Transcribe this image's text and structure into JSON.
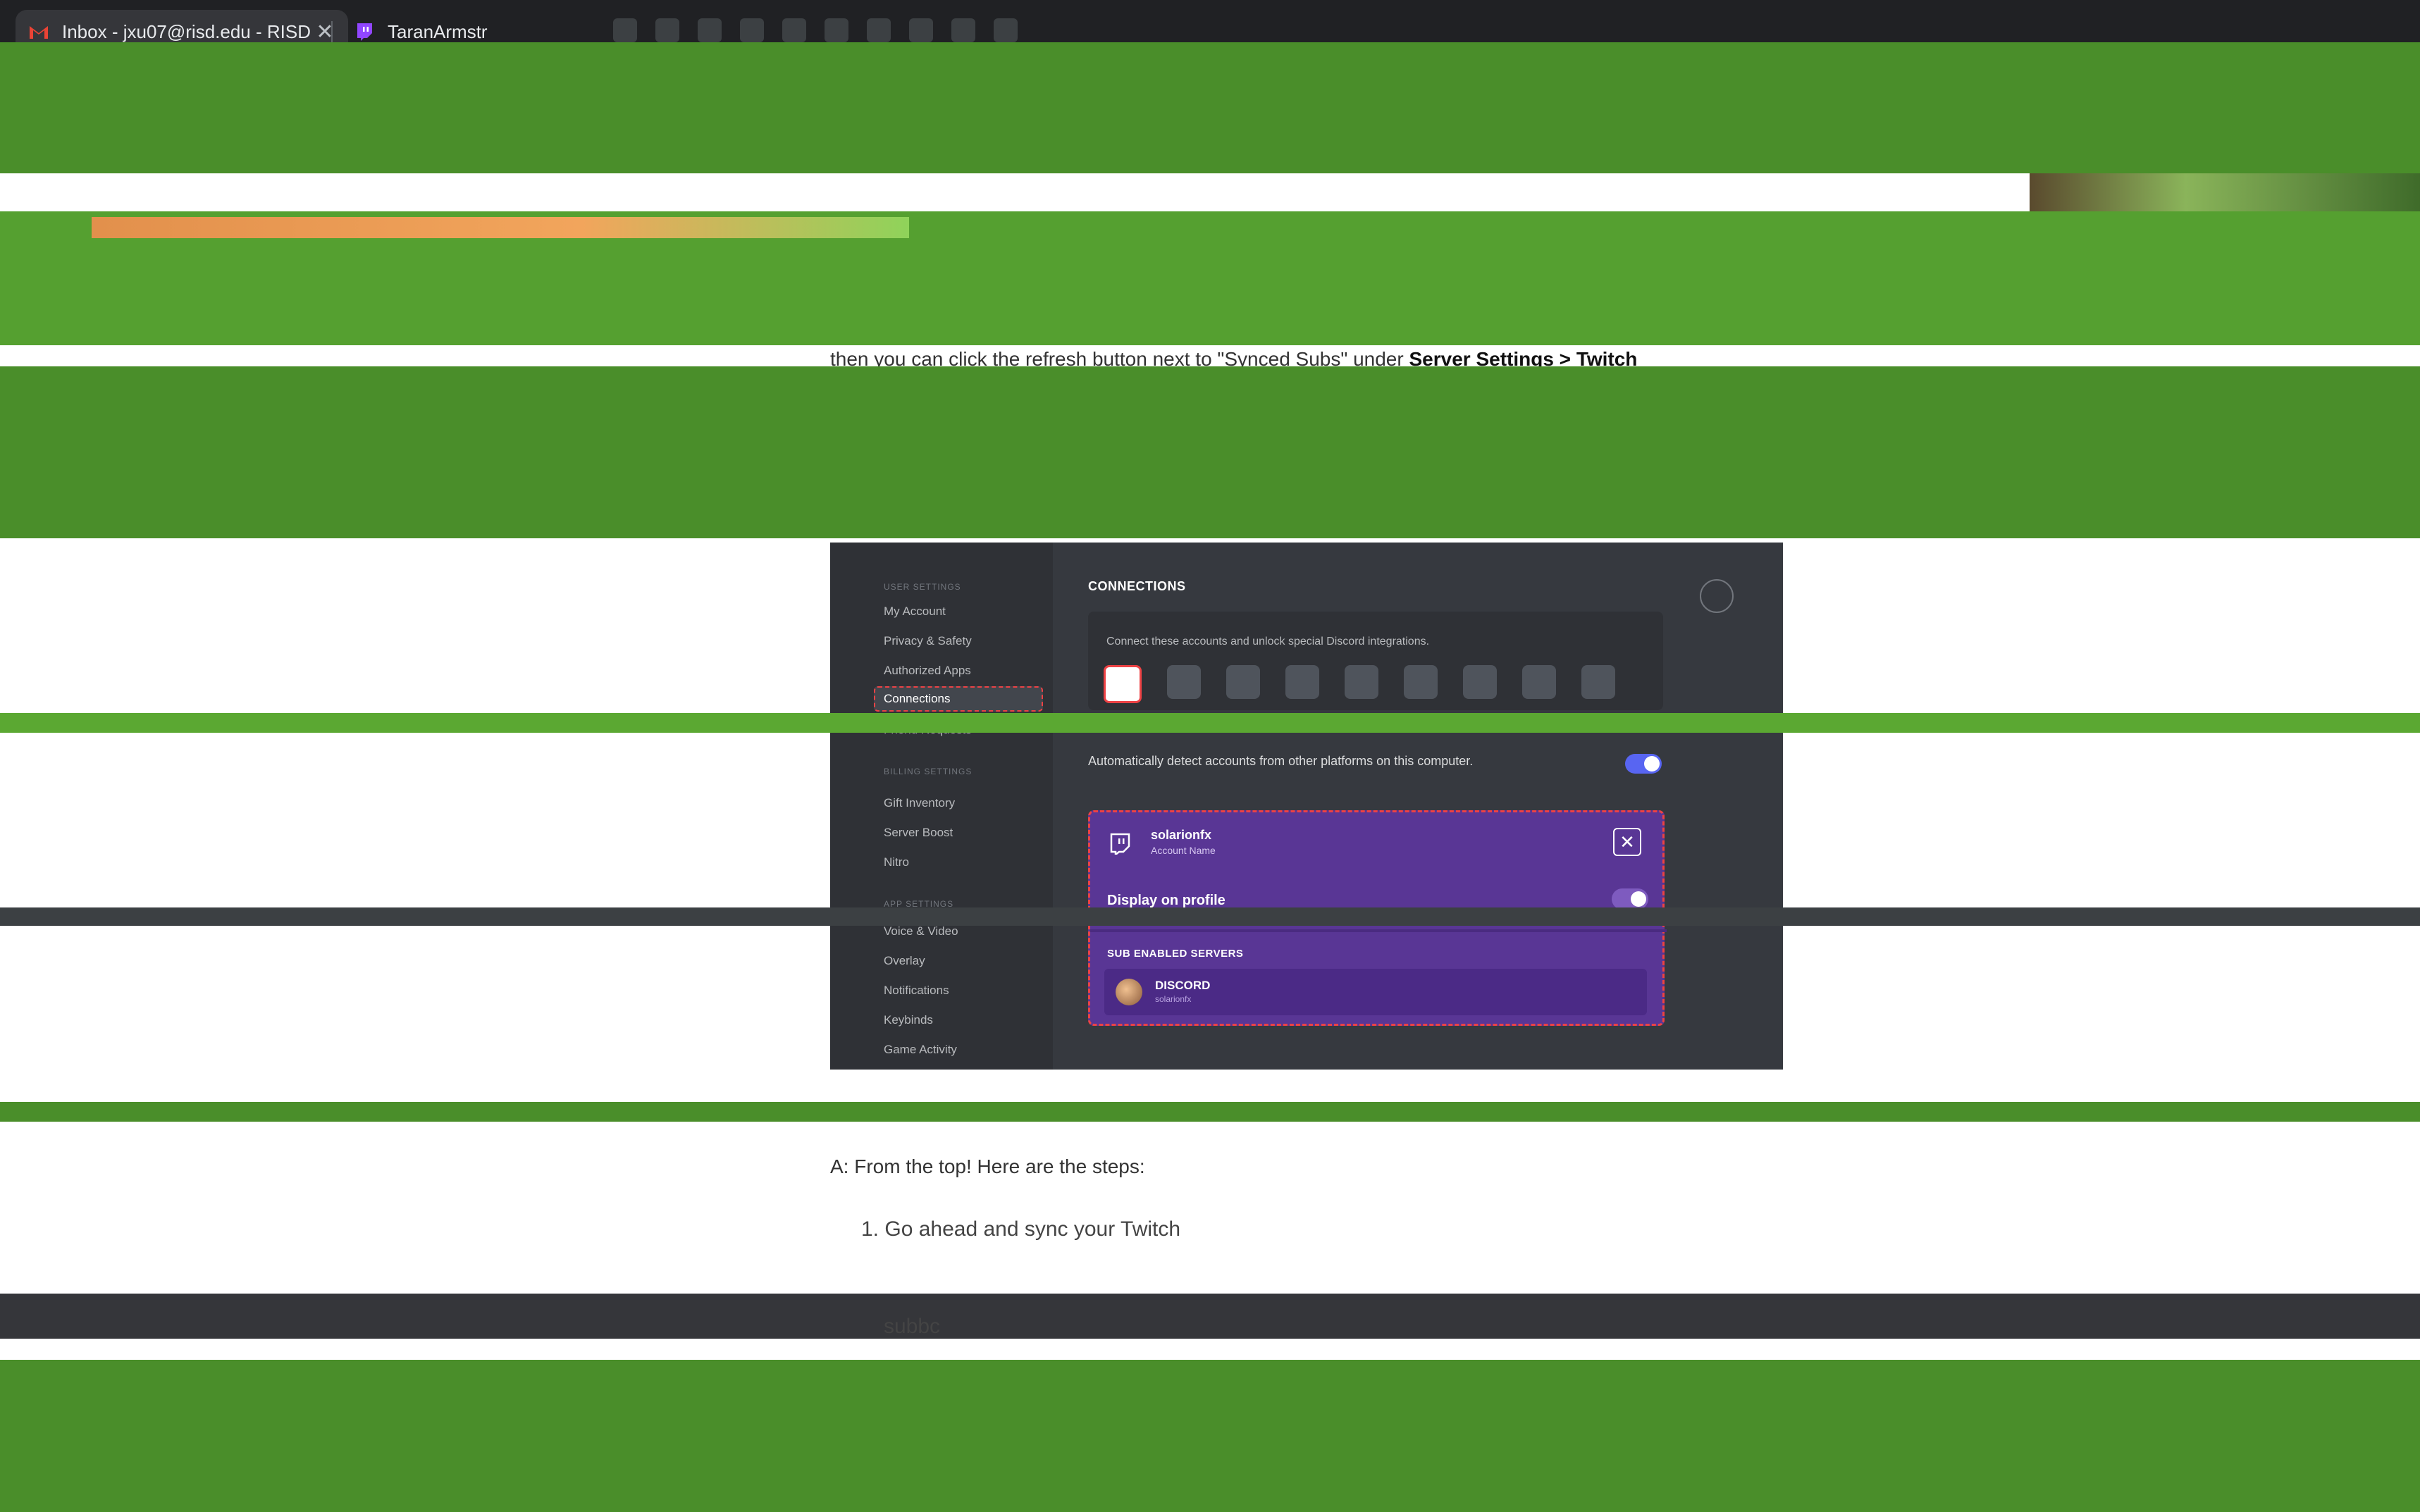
{
  "browser": {
    "tabs": [
      {
        "label": "Inbox - jxu07@risd.edu - RISD",
        "icon": "gmail-icon",
        "close": "✕"
      },
      {
        "label": "TaranArmstr",
        "icon": "twitch-icon"
      }
    ]
  },
  "article": {
    "line1_pre": "then you can click the refresh button next to \"Synced Subs\" under ",
    "line1_bold": "Server Settings > Twitch",
    "answer_intro": "A: From the top! Here are the steps:",
    "step1": "1. Go ahead and sync your Twitch",
    "step1_cont": "subbc"
  },
  "screenshot": {
    "sidebar": {
      "heading": "USER SETTINGS",
      "items": [
        "My Account",
        "Privacy & Safety",
        "Authorized Apps",
        "Connections",
        "Friend Requests",
        "BILLING SETTINGS",
        "Gift Inventory",
        "Server Boost",
        "Nitro",
        "APP SETTINGS",
        "Voice & Video",
        "Overlay",
        "Notifications",
        "Keybinds",
        "Game Activity"
      ]
    },
    "title": "CONNECTIONS",
    "connect_text": "Connect these accounts and unlock special Discord integrations.",
    "auto_detect": "Automatically detect accounts from other platforms on this computer.",
    "twitch_card": {
      "account_name": "solarionfx",
      "account_label": "Account Name",
      "close": "✕",
      "display_on_profile": "Display on profile",
      "sub_enabled_servers": "SUB ENABLED SERVERS",
      "server_name": "DISCORD",
      "server_sub": "solarionfx"
    }
  },
  "colors": {
    "background": "#ffffff",
    "twitch_purple": "#593695",
    "discord_dark": "#36393f",
    "highlight_red": "#ed4245",
    "green_band": "#4a8e2a"
  }
}
